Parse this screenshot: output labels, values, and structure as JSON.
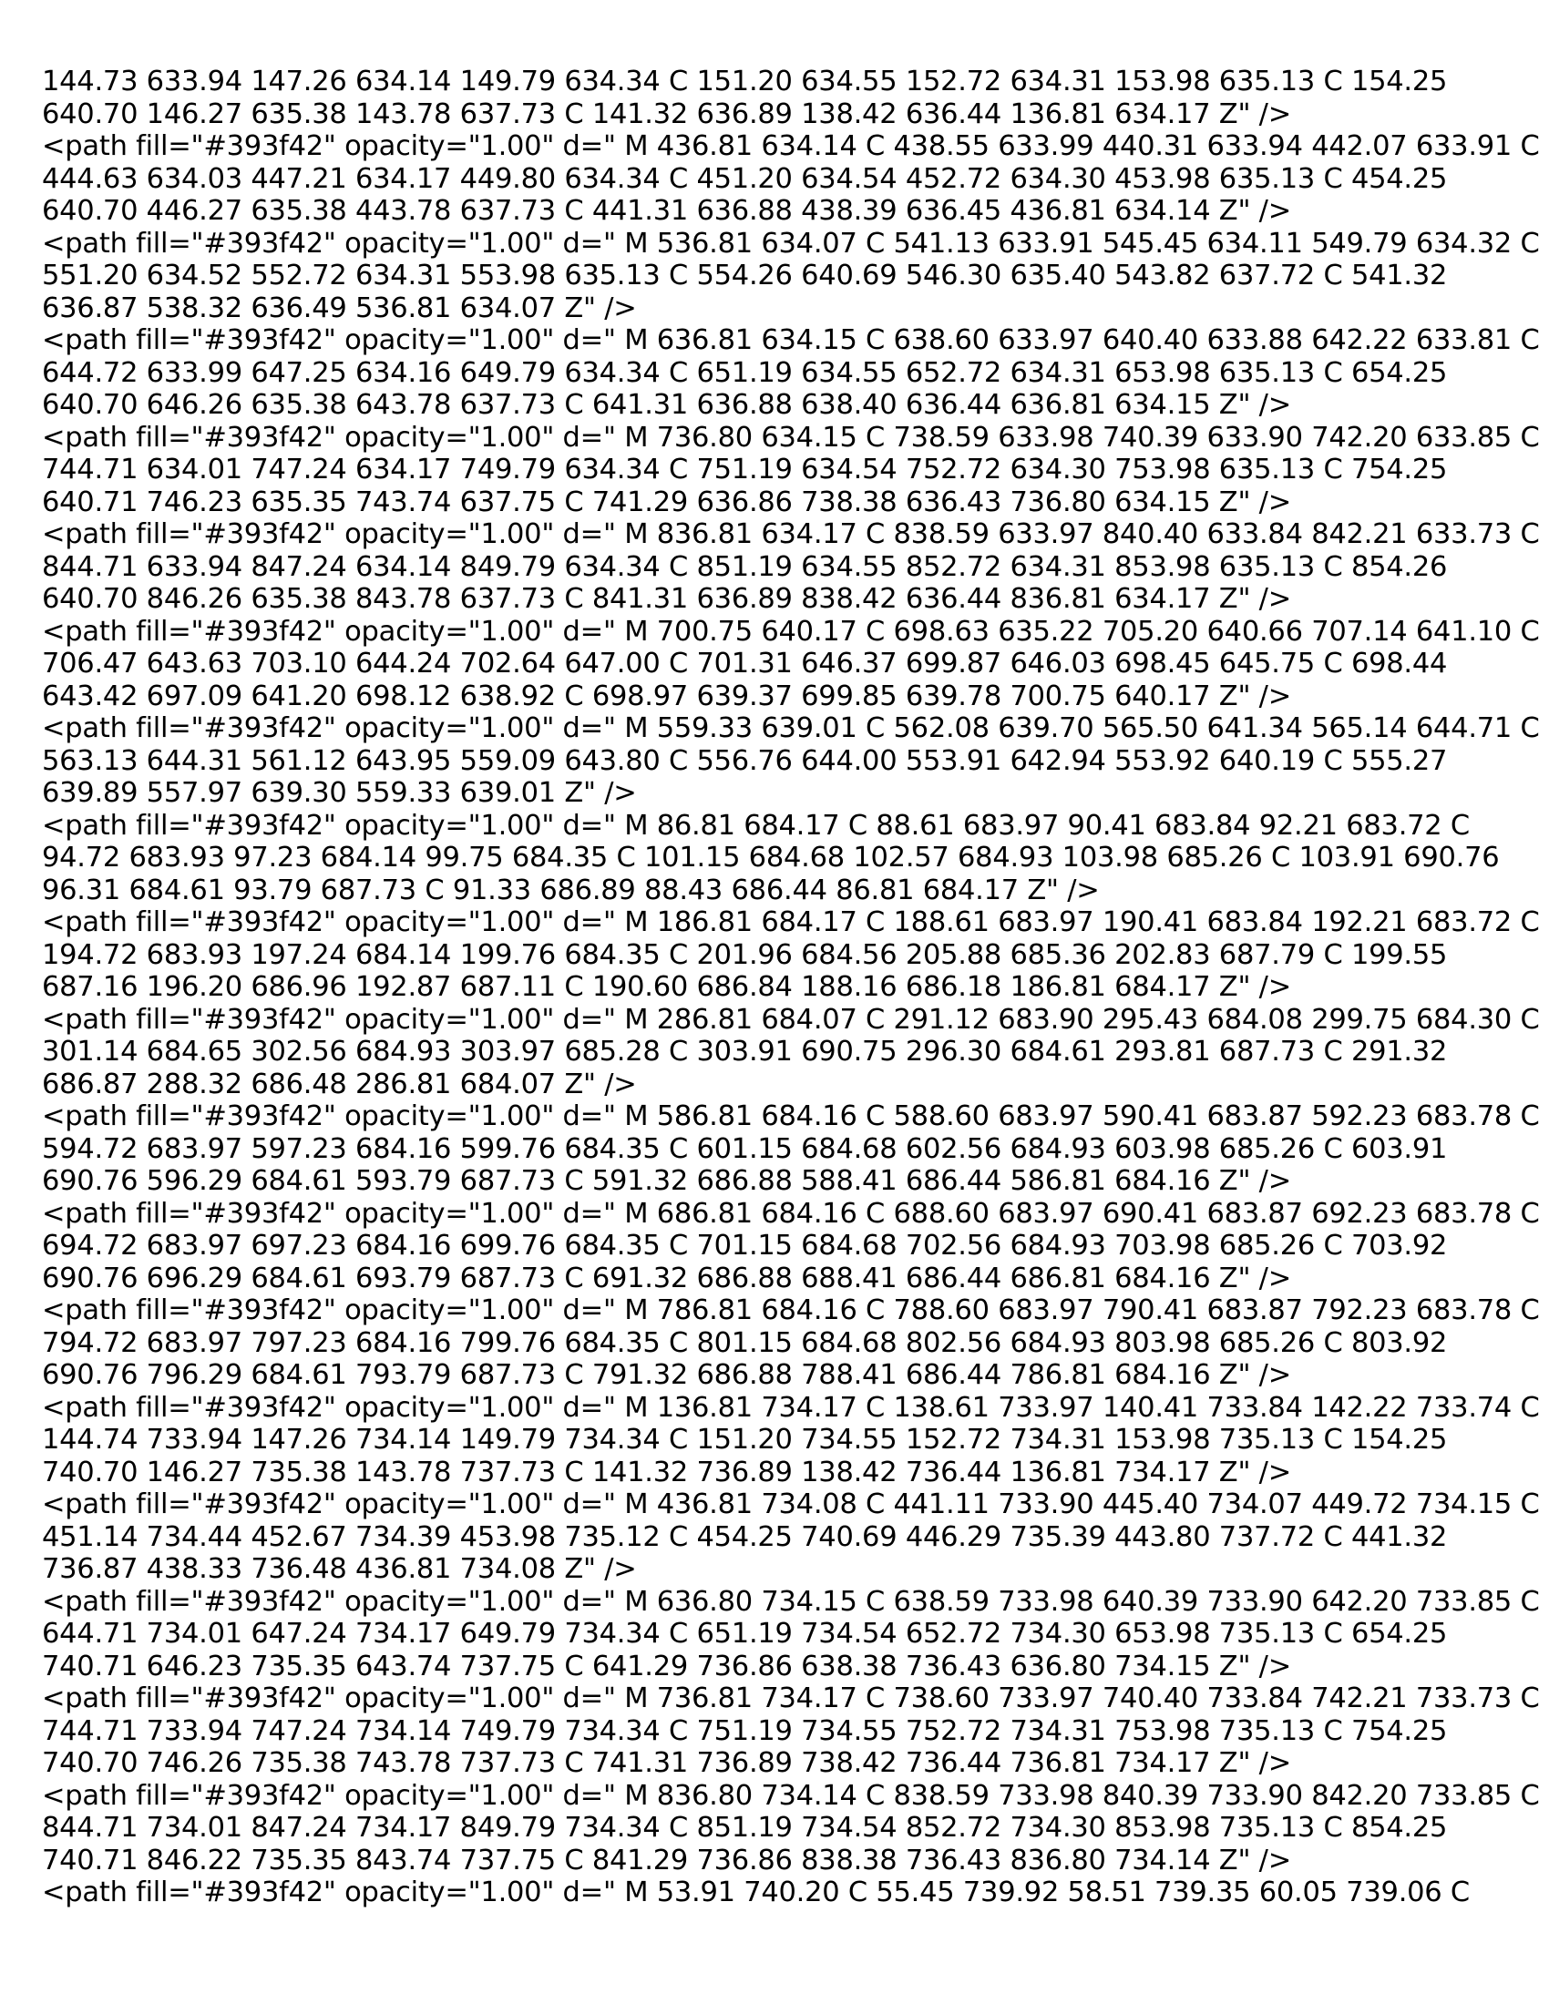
{
  "document": {
    "lines": [
      "144.73 633.94 147.26 634.14 149.79 634.34 C 151.20 634.55 152.72 634.31 153.98 635.13 C 154.25",
      "640.70 146.27 635.38 143.78 637.73 C 141.32 636.89 138.42 636.44 136.81 634.17 Z\" />",
      "<path fill=\"#393f42\" opacity=\"1.00\" d=\" M 436.81 634.14 C 438.55 633.99 440.31 633.94 442.07 633.91 C",
      "444.63 634.03 447.21 634.17 449.80 634.34 C 451.20 634.54 452.72 634.30 453.98 635.13 C 454.25",
      "640.70 446.27 635.38 443.78 637.73 C 441.31 636.88 438.39 636.45 436.81 634.14 Z\" />",
      "<path fill=\"#393f42\" opacity=\"1.00\" d=\" M 536.81 634.07 C 541.13 633.91 545.45 634.11 549.79 634.32 C",
      "551.20 634.52 552.72 634.31 553.98 635.13 C 554.26 640.69 546.30 635.40 543.82 637.72 C 541.32",
      "636.87 538.32 636.49 536.81 634.07 Z\" />",
      "<path fill=\"#393f42\" opacity=\"1.00\" d=\" M 636.81 634.15 C 638.60 633.97 640.40 633.88 642.22 633.81 C",
      "644.72 633.99 647.25 634.16 649.79 634.34 C 651.19 634.55 652.72 634.31 653.98 635.13 C 654.25",
      "640.70 646.26 635.38 643.78 637.73 C 641.31 636.88 638.40 636.44 636.81 634.15 Z\" />",
      "<path fill=\"#393f42\" opacity=\"1.00\" d=\" M 736.80 634.15 C 738.59 633.98 740.39 633.90 742.20 633.85 C",
      "744.71 634.01 747.24 634.17 749.79 634.34 C 751.19 634.54 752.72 634.30 753.98 635.13 C 754.25",
      "640.71 746.23 635.35 743.74 637.75 C 741.29 636.86 738.38 636.43 736.80 634.15 Z\" />",
      "<path fill=\"#393f42\" opacity=\"1.00\" d=\" M 836.81 634.17 C 838.59 633.97 840.40 633.84 842.21 633.73 C",
      "844.71 633.94 847.24 634.14 849.79 634.34 C 851.19 634.55 852.72 634.31 853.98 635.13 C 854.26",
      "640.70 846.26 635.38 843.78 637.73 C 841.31 636.89 838.42 636.44 836.81 634.17 Z\" />",
      "<path fill=\"#393f42\" opacity=\"1.00\" d=\" M 700.75 640.17 C 698.63 635.22 705.20 640.66 707.14 641.10 C",
      "706.47 643.63 703.10 644.24 702.64 647.00 C 701.31 646.37 699.87 646.03 698.45 645.75 C 698.44",
      "643.42 697.09 641.20 698.12 638.92 C 698.97 639.37 699.85 639.78 700.75 640.17 Z\" />",
      "<path fill=\"#393f42\" opacity=\"1.00\" d=\" M 559.33 639.01 C 562.08 639.70 565.50 641.34 565.14 644.71 C",
      "563.13 644.31 561.12 643.95 559.09 643.80 C 556.76 644.00 553.91 642.94 553.92 640.19 C 555.27",
      "639.89 557.97 639.30 559.33 639.01 Z\" />",
      "<path fill=\"#393f42\" opacity=\"1.00\" d=\" M 86.81 684.17 C 88.61 683.97 90.41 683.84 92.21 683.72 C",
      "94.72 683.93 97.23 684.14 99.75 684.35 C 101.15 684.68 102.57 684.93 103.98 685.26 C 103.91 690.76",
      "96.31 684.61 93.79 687.73 C 91.33 686.89 88.43 686.44 86.81 684.17 Z\" />",
      "<path fill=\"#393f42\" opacity=\"1.00\" d=\" M 186.81 684.17 C 188.61 683.97 190.41 683.84 192.21 683.72 C",
      "194.72 683.93 197.24 684.14 199.76 684.35 C 201.96 684.56 205.88 685.36 202.83 687.79 C 199.55",
      "687.16 196.20 686.96 192.87 687.11 C 190.60 686.84 188.16 686.18 186.81 684.17 Z\" />",
      "<path fill=\"#393f42\" opacity=\"1.00\" d=\" M 286.81 684.07 C 291.12 683.90 295.43 684.08 299.75 684.30 C",
      "301.14 684.65 302.56 684.93 303.97 685.28 C 303.91 690.75 296.30 684.61 293.81 687.73 C 291.32",
      "686.87 288.32 686.48 286.81 684.07 Z\" />",
      "<path fill=\"#393f42\" opacity=\"1.00\" d=\" M 586.81 684.16 C 588.60 683.97 590.41 683.87 592.23 683.78 C",
      "594.72 683.97 597.23 684.16 599.76 684.35 C 601.15 684.68 602.56 684.93 603.98 685.26 C 603.91",
      "690.76 596.29 684.61 593.79 687.73 C 591.32 686.88 588.41 686.44 586.81 684.16 Z\" />",
      "<path fill=\"#393f42\" opacity=\"1.00\" d=\" M 686.81 684.16 C 688.60 683.97 690.41 683.87 692.23 683.78 C",
      "694.72 683.97 697.23 684.16 699.76 684.35 C 701.15 684.68 702.56 684.93 703.98 685.26 C 703.92",
      "690.76 696.29 684.61 693.79 687.73 C 691.32 686.88 688.41 686.44 686.81 684.16 Z\" />",
      "<path fill=\"#393f42\" opacity=\"1.00\" d=\" M 786.81 684.16 C 788.60 683.97 790.41 683.87 792.23 683.78 C",
      "794.72 683.97 797.23 684.16 799.76 684.35 C 801.15 684.68 802.56 684.93 803.98 685.26 C 803.92",
      "690.76 796.29 684.61 793.79 687.73 C 791.32 686.88 788.41 686.44 786.81 684.16 Z\" />",
      "<path fill=\"#393f42\" opacity=\"1.00\" d=\" M 136.81 734.17 C 138.61 733.97 140.41 733.84 142.22 733.74 C",
      "144.74 733.94 147.26 734.14 149.79 734.34 C 151.20 734.55 152.72 734.31 153.98 735.13 C 154.25",
      "740.70 146.27 735.38 143.78 737.73 C 141.32 736.89 138.42 736.44 136.81 734.17 Z\" />",
      "<path fill=\"#393f42\" opacity=\"1.00\" d=\" M 436.81 734.08 C 441.11 733.90 445.40 734.07 449.72 734.15 C",
      "451.14 734.44 452.67 734.39 453.98 735.12 C 454.25 740.69 446.29 735.39 443.80 737.72 C 441.32",
      "736.87 438.33 736.48 436.81 734.08 Z\" />",
      "<path fill=\"#393f42\" opacity=\"1.00\" d=\" M 636.80 734.15 C 638.59 733.98 640.39 733.90 642.20 733.85 C",
      "644.71 734.01 647.24 734.17 649.79 734.34 C 651.19 734.54 652.72 734.30 653.98 735.13 C 654.25",
      "740.71 646.23 735.35 643.74 737.75 C 641.29 736.86 638.38 736.43 636.80 734.15 Z\" />",
      "<path fill=\"#393f42\" opacity=\"1.00\" d=\" M 736.81 734.17 C 738.60 733.97 740.40 733.84 742.21 733.73 C",
      "744.71 733.94 747.24 734.14 749.79 734.34 C 751.19 734.55 752.72 734.31 753.98 735.13 C 754.25",
      "740.70 746.26 735.38 743.78 737.73 C 741.31 736.89 738.42 736.44 736.81 734.17 Z\" />",
      "<path fill=\"#393f42\" opacity=\"1.00\" d=\" M 836.80 734.14 C 838.59 733.98 840.39 733.90 842.20 733.85 C",
      "844.71 734.01 847.24 734.17 849.79 734.34 C 851.19 734.54 852.72 734.30 853.98 735.13 C 854.25",
      "740.71 846.22 735.35 843.74 737.75 C 841.29 736.86 838.38 736.43 836.80 734.14 Z\" />",
      "<path fill=\"#393f42\" opacity=\"1.00\" d=\" M 53.91 740.20 C 55.45 739.92 58.51 739.35 60.05 739.06 C"
    ]
  }
}
